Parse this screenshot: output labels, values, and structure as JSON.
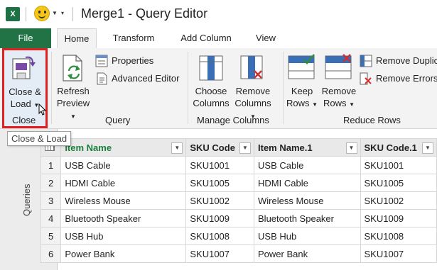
{
  "window": {
    "title": "Merge1 - Query Editor"
  },
  "tabs": [
    {
      "label": "File"
    },
    {
      "label": "Home"
    },
    {
      "label": "Transform"
    },
    {
      "label": "Add Column"
    },
    {
      "label": "View"
    }
  ],
  "ribbon": {
    "close_load": {
      "line1": "Close &",
      "line2": "Load"
    },
    "refresh_preview": {
      "line1": "Refresh",
      "line2": "Preview"
    },
    "properties": "Properties",
    "advanced_editor": "Advanced Editor",
    "choose_columns": {
      "line1": "Choose",
      "line2": "Columns"
    },
    "remove_columns": {
      "line1": "Remove",
      "line2": "Columns"
    },
    "keep_rows": {
      "line1": "Keep",
      "line2": "Rows"
    },
    "remove_rows": {
      "line1": "Remove",
      "line2": "Rows"
    },
    "remove_duplicates": "Remove Duplic",
    "remove_errors": "Remove Errors",
    "groups": {
      "close": "Close",
      "query": "Query",
      "manage_columns": "Manage Columns",
      "reduce_rows": "Reduce Rows"
    }
  },
  "tooltip": "Close & Load",
  "queries_pane": {
    "label": "Queries"
  },
  "table": {
    "columns": [
      "Item Name",
      "SKU Code",
      "Item Name.1",
      "SKU Code.1"
    ],
    "rows": [
      [
        "1",
        "USB Cable",
        "SKU1001",
        "USB Cable",
        "SKU1001"
      ],
      [
        "2",
        "HDMI Cable",
        "SKU1005",
        "HDMI Cable",
        "SKU1005"
      ],
      [
        "3",
        "Wireless Mouse",
        "SKU1002",
        "Wireless Mouse",
        "SKU1002"
      ],
      [
        "4",
        "Bluetooth Speaker",
        "SKU1009",
        "Bluetooth Speaker",
        "SKU1009"
      ],
      [
        "5",
        "USB Hub",
        "SKU1008",
        "USB Hub",
        "SKU1008"
      ],
      [
        "6",
        "Power Bank",
        "SKU1007",
        "Power Bank",
        "SKU1007"
      ]
    ]
  },
  "colors": {
    "excel_green": "#217346",
    "highlight_red": "#e02020",
    "header_green_text": "#1a7f3c"
  }
}
